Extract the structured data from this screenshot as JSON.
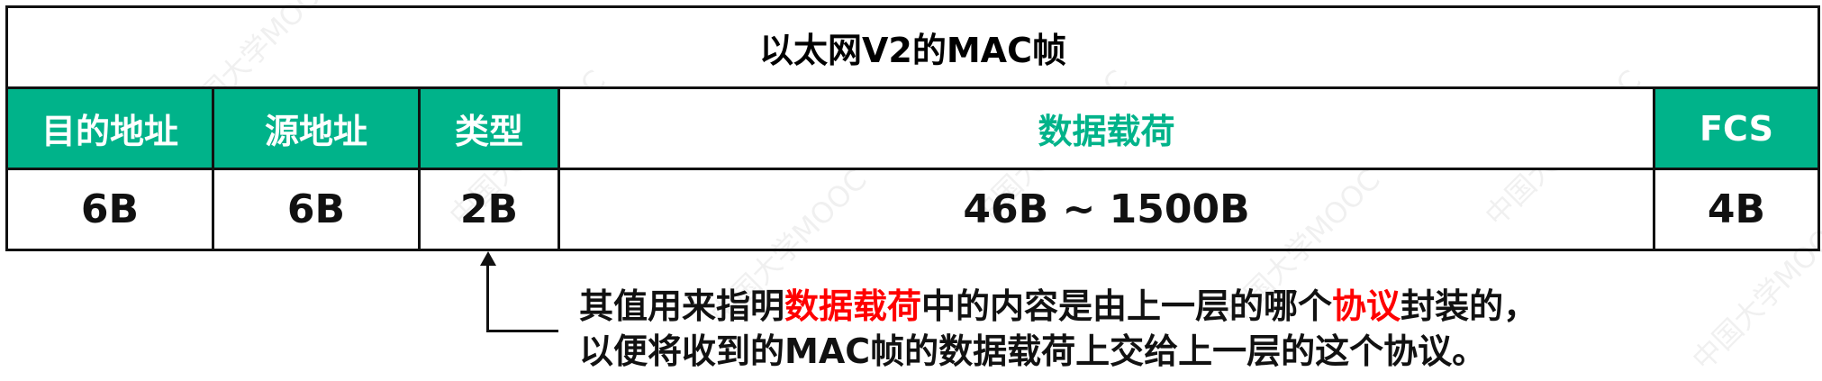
{
  "title": "以太网V2的MAC帧",
  "headers": [
    "目的地址",
    "源地址",
    "类型",
    "数据载荷",
    "FCS"
  ],
  "values": [
    "6B",
    "6B",
    "2B",
    "46B ~ 1500B",
    "4B"
  ],
  "note": {
    "line1_part1": "其值用来指明",
    "line1_red1": "数据载荷",
    "line1_part2": "中的内容是由上一层的哪个",
    "line1_red2": "协议",
    "line1_part3": "封装的，",
    "line2": "以便将收到的MAC帧的数据载荷上交给上一层的这个协议。"
  },
  "watermark": "中国大学MOOC",
  "colors": {
    "accent": "#00b38a",
    "highlight": "#ff0000"
  }
}
